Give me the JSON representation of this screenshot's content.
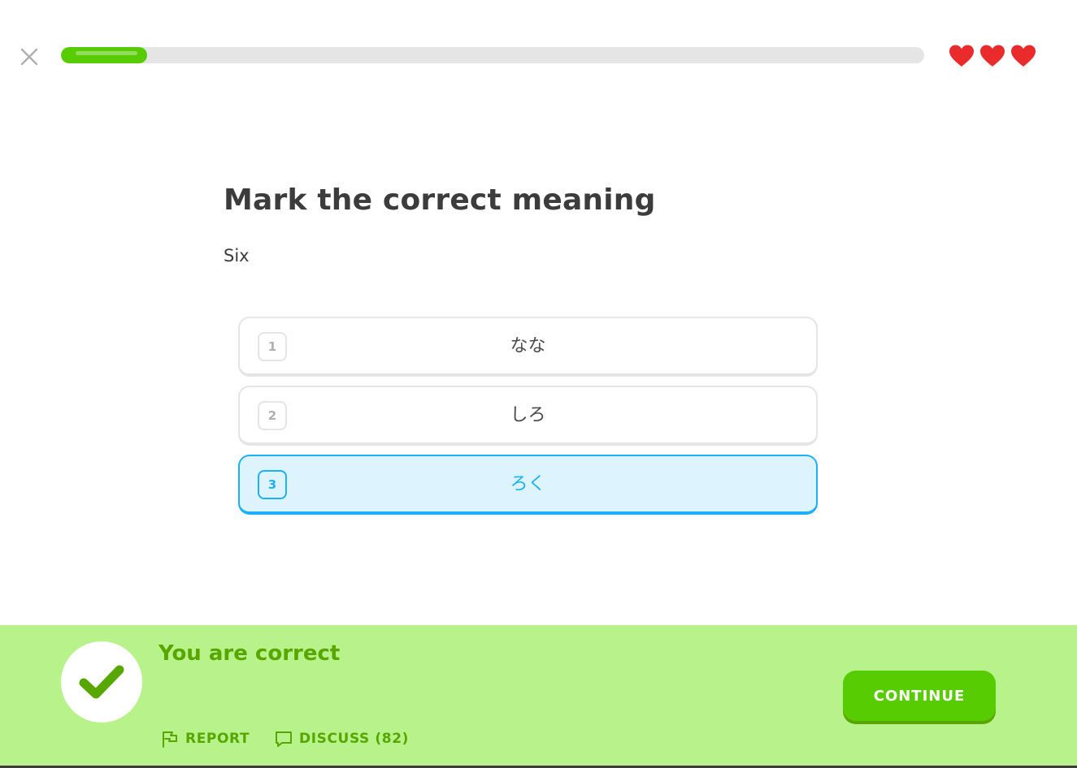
{
  "header": {
    "progress_fraction": 0.1,
    "hearts_count": 3,
    "heart_color": "#ea2b2b",
    "progress_color": "#58cc02"
  },
  "question": {
    "title": "Mark the correct meaning",
    "prompt": "Six"
  },
  "choices": [
    {
      "number": "1",
      "label": "なな",
      "selected": false
    },
    {
      "number": "2",
      "label": "しろ",
      "selected": false
    },
    {
      "number": "3",
      "label": "ろく",
      "selected": true
    }
  ],
  "feedback": {
    "title": "You are correct",
    "report_label": "REPORT",
    "discuss_label": "DISCUSS (82)",
    "continue_label": "CONTINUE",
    "background_color": "#b8f28b",
    "accent_color": "#58a700"
  }
}
